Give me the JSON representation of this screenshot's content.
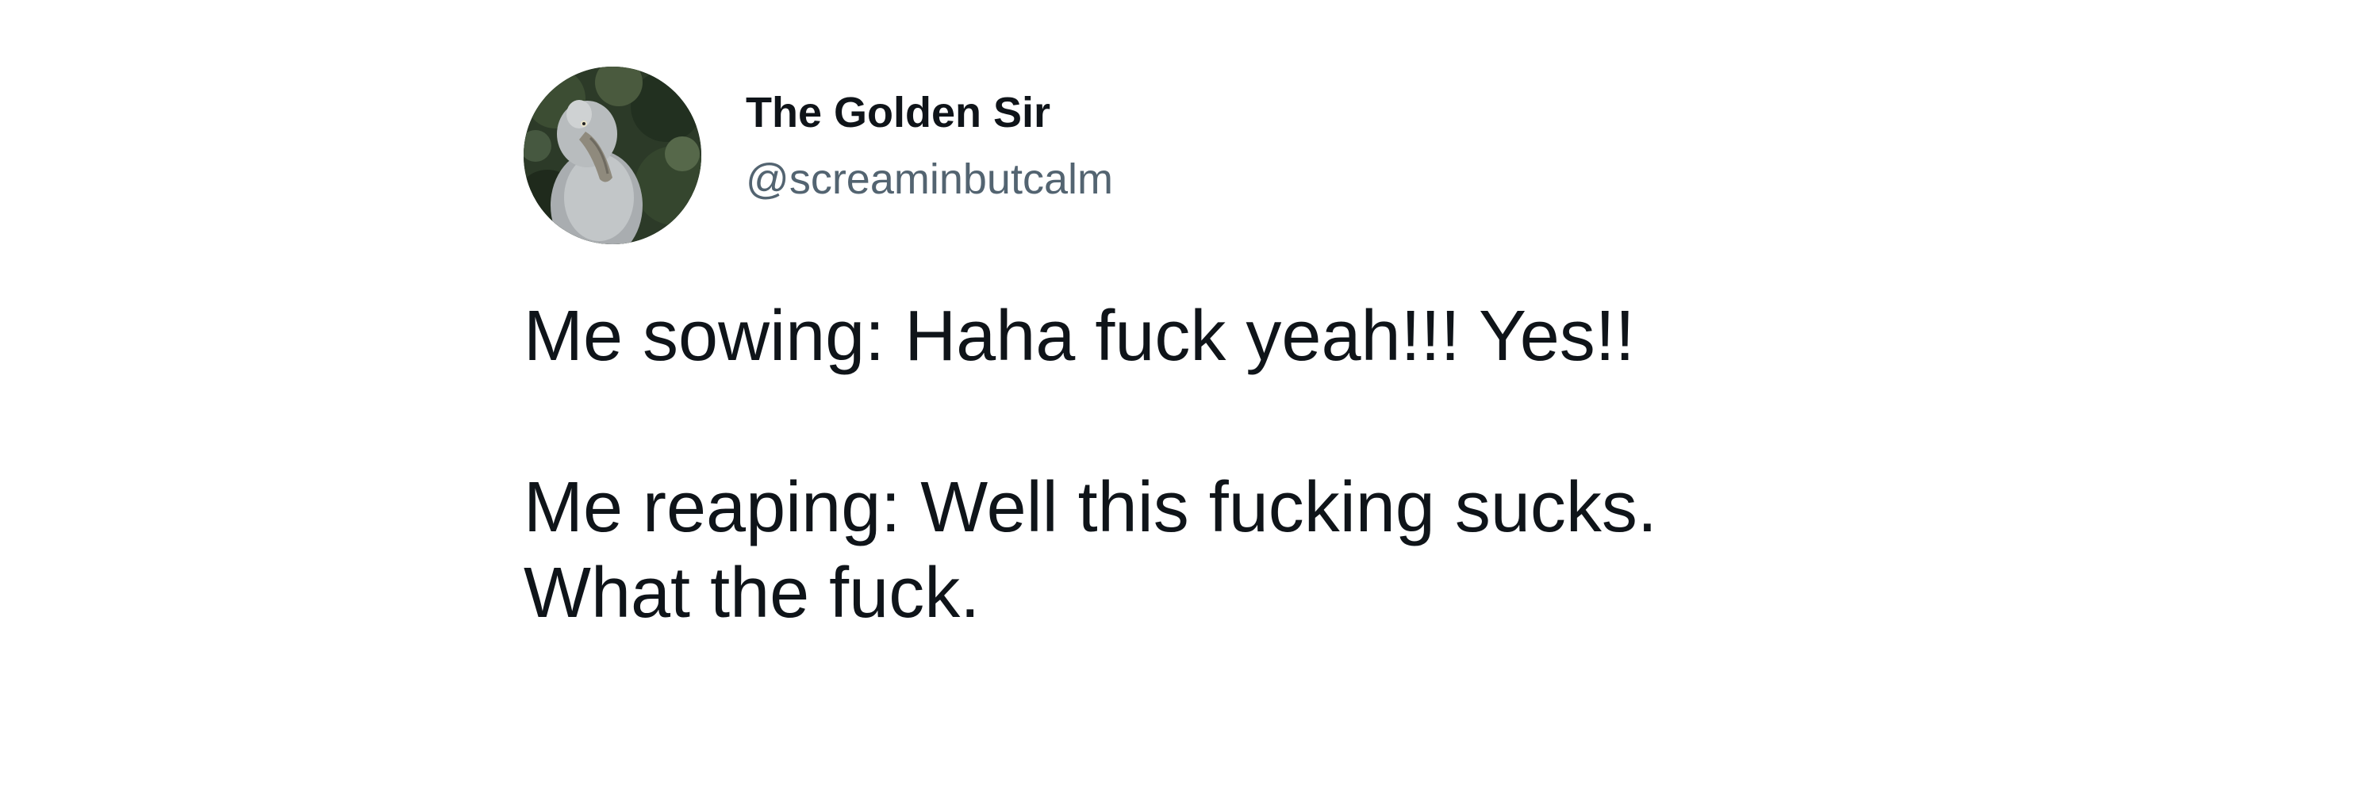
{
  "tweet": {
    "author": {
      "display_name": "The Golden Sir",
      "handle": "@screaminbutcalm",
      "avatar_icon": "shoebill-bird-avatar"
    },
    "text": {
      "line1": "Me sowing: Haha fuck yeah!!! Yes!!",
      "line2": "Me reaping: Well this fucking sucks.",
      "line3": "What the fuck."
    }
  }
}
